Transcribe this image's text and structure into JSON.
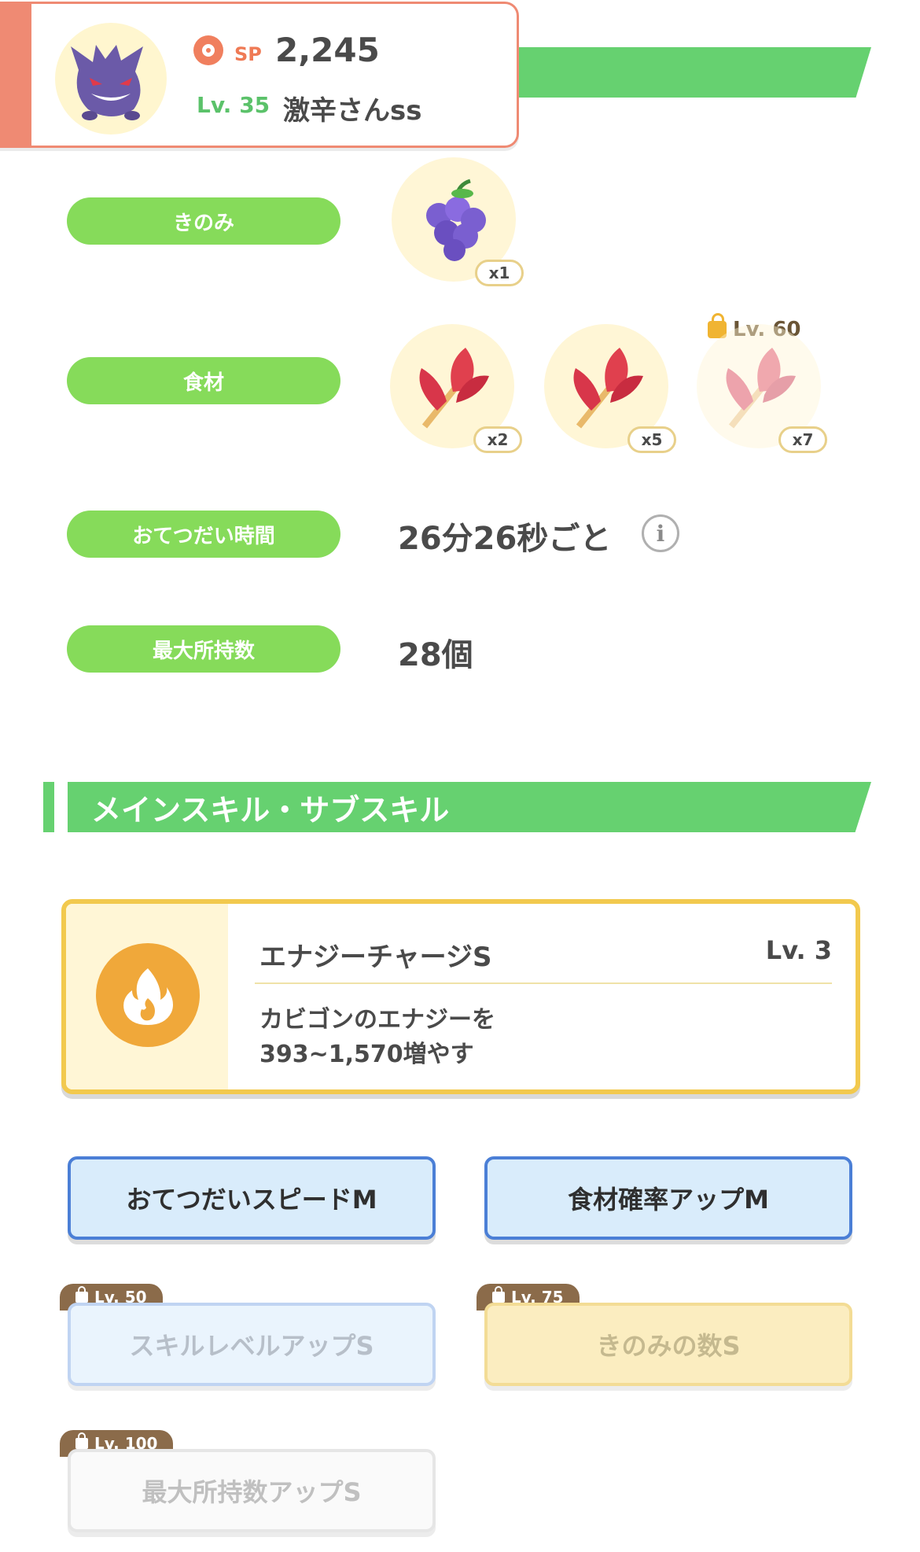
{
  "profile": {
    "sp_label": "SP",
    "sp_value": "2,245",
    "level": "Lv. 35",
    "nickname": "激辛さんss"
  },
  "rows": {
    "berry_label": "きのみ",
    "berry_qty": "x1",
    "ingredient_label": "食材",
    "ingredient_qty_1": "x2",
    "ingredient_qty_2": "x5",
    "ingredient_qty_3": "x7",
    "ingredient_lock_level": "Lv. 60",
    "help_time_label": "おてつだい時間",
    "help_time_value": "26分26秒ごと",
    "max_carry_label": "最大所持数",
    "max_carry_value": "28個"
  },
  "section": {
    "title": "メインスキル・サブスキル"
  },
  "main_skill": {
    "name": "エナジーチャージS",
    "level": "Lv. 3",
    "desc_line1": "カビゴンのエナジーを",
    "desc_line2": "393~1,570増やす"
  },
  "sub_skills": [
    {
      "label": "おてつだいスピードM",
      "lock": ""
    },
    {
      "label": "食材確率アップM",
      "lock": ""
    },
    {
      "label": "スキルレベルアップS",
      "lock": "Lv. 50"
    },
    {
      "label": "きのみの数S",
      "lock": "Lv. 75"
    },
    {
      "label": "最大所持数アップS",
      "lock": "Lv. 100"
    }
  ]
}
